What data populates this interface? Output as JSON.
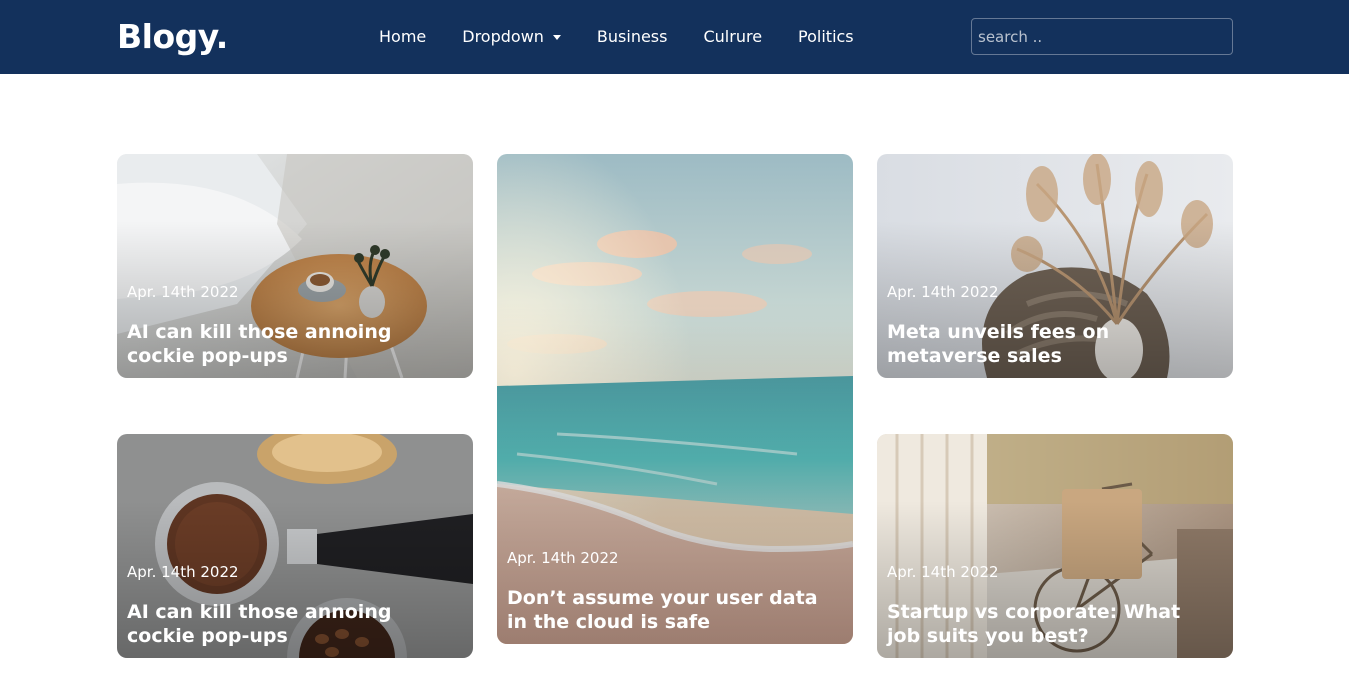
{
  "brand": "Blogy.",
  "nav": {
    "home": "Home",
    "dropdown": "Dropdown",
    "business": "Business",
    "culture": "Culrure",
    "politics": "Politics"
  },
  "search": {
    "placeholder": "search .."
  },
  "posts": [
    {
      "date": "Apr. 14th 2022",
      "title": "AI can kill those annoing cockie pop-ups",
      "image": "coffee-table-photo"
    },
    {
      "date": "Apr. 14th 2022",
      "title": "Don’t assume your user data in the cloud is safe",
      "image": "beach-sunset-photo"
    },
    {
      "date": "Apr. 14th 2022",
      "title": "Meta unveils fees on metaverse sales",
      "image": "pampas-grass-vase-photo"
    },
    {
      "date": "Apr. 14th 2022",
      "title": "AI can kill those annoing cockie pop-ups",
      "image": "coffee-grounds-photo"
    },
    {
      "date": "Apr. 14th 2022",
      "title": "Startup vs corporate: What job suits you best?",
      "image": "bicycle-interior-photo"
    }
  ],
  "colors": {
    "navbar": "#13315c",
    "text": "#ffffff"
  }
}
